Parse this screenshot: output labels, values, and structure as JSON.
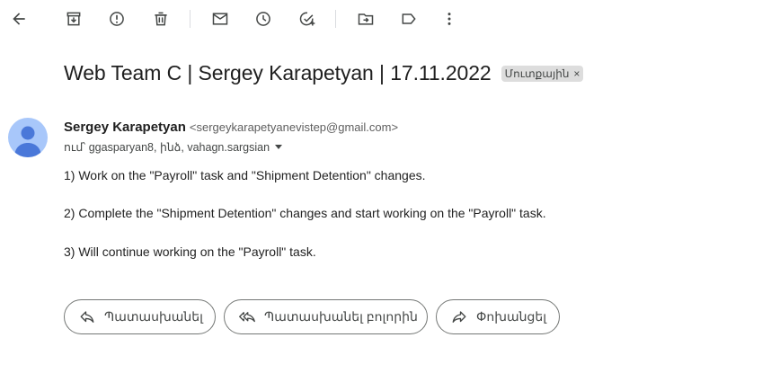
{
  "toolbar": {
    "items": [
      {
        "name": "back-arrow-icon",
        "label": "Back"
      },
      {
        "name": "archive-icon",
        "label": "Archive"
      },
      {
        "name": "report-spam-icon",
        "label": "Report spam"
      },
      {
        "name": "delete-icon",
        "label": "Delete"
      },
      {
        "name": "mark-unread-icon",
        "label": "Mark as unread"
      },
      {
        "name": "snooze-icon",
        "label": "Snooze"
      },
      {
        "name": "add-task-icon",
        "label": "Add to Tasks"
      },
      {
        "name": "move-to-icon",
        "label": "Move to"
      },
      {
        "name": "label-icon",
        "label": "Labels"
      },
      {
        "name": "more-options-icon",
        "label": "More"
      }
    ]
  },
  "message": {
    "subject": "Web Team C | Sergey Karapetyan | 17.11.2022",
    "label_chip": "Մուտքային",
    "label_chip_close": "×",
    "sender_name": "Sergey Karapetyan",
    "sender_email": "<sergeykarapetyanevistep@gmail.com>",
    "recipients": "ում՝ ggasparyan8, ինձ, vahagn.sargsian",
    "body": [
      "1) Work on the \"Payroll\" task and \"Shipment Detention\" changes.",
      "2) Complete the \"Shipment Detention\" changes and start working on the \"Payroll\" task.",
      "3) Will continue working on the \"Payroll\" task."
    ]
  },
  "actions": {
    "reply": "Պատասխանել",
    "reply_all": "Պատասխանել բոլորին",
    "forward": "Փոխանցել"
  },
  "colors": {
    "icon": "#444746",
    "avatar_bg": "#a8c7fa",
    "avatar_fg": "#4a78d9"
  }
}
